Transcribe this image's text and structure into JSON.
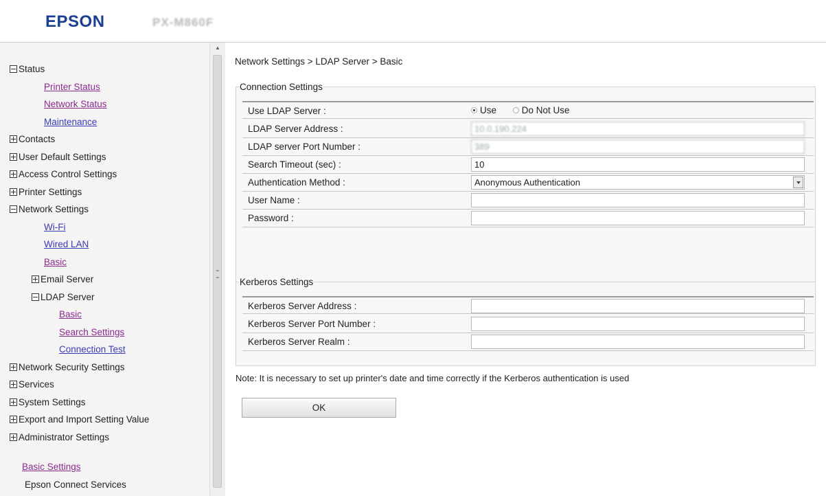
{
  "header": {
    "brand": "EPSON",
    "model": "PX-M860F"
  },
  "sidebar": {
    "status": "Status",
    "printer_status": "Printer Status",
    "network_status": "Network Status",
    "maintenance": "Maintenance",
    "contacts": "Contacts",
    "user_default_settings": "User Default Settings",
    "access_control_settings": "Access Control Settings",
    "printer_settings": "Printer Settings",
    "network_settings": "Network Settings",
    "wifi": "Wi-Fi",
    "wired_lan": "Wired LAN",
    "basic": "Basic",
    "email_server": "Email Server",
    "ldap_server": "LDAP Server",
    "ldap_basic": "Basic",
    "search_settings": "Search Settings",
    "connection_test": "Connection Test",
    "network_security_settings": "Network Security Settings",
    "services": "Services",
    "system_settings": "System Settings",
    "export_import": "Export and Import Setting Value",
    "administrator_settings": "Administrator Settings",
    "basic_settings": "Basic Settings",
    "epson_connect": "Epson Connect Services"
  },
  "main": {
    "breadcrumb": "Network Settings > LDAP Server > Basic",
    "connection": {
      "legend": "Connection Settings",
      "use_ldap_label": "Use LDAP Server :",
      "use_option": "Use",
      "do_not_use_option": "Do Not Use",
      "selected": "Use",
      "address_label": "LDAP Server Address :",
      "address_value": "10.0.190.224",
      "port_label": "LDAP server Port Number :",
      "port_value": "389",
      "timeout_label": "Search Timeout (sec) :",
      "timeout_value": "10",
      "auth_label": "Authentication Method :",
      "auth_value": "Anonymous Authentication",
      "username_label": "User Name :",
      "username_value": "",
      "password_label": "Password :",
      "password_value": ""
    },
    "kerberos": {
      "legend": "Kerberos Settings",
      "address_label": "Kerberos Server Address :",
      "address_value": "",
      "port_label": "Kerberos Server Port Number :",
      "port_value": "",
      "realm_label": "Kerberos Server Realm :",
      "realm_value": ""
    },
    "note": "Note: It is necessary to set up printer's date and time correctly if the Kerberos authentication is used",
    "ok_label": "OK"
  }
}
